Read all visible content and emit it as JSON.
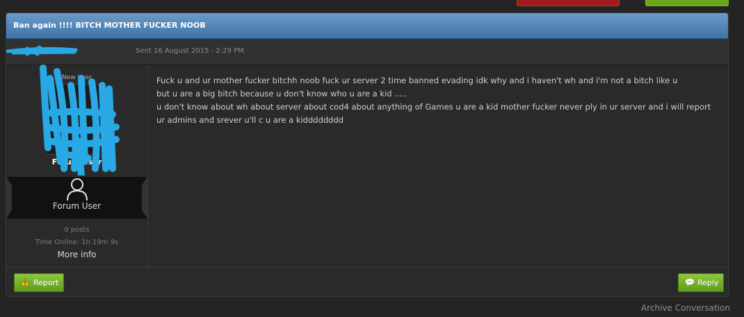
{
  "conversation": {
    "title": "Ban again !!!! BITCH MOTHER FUCKER NOOB",
    "sent": "Sent 16 August 2015 - 2:29 PM"
  },
  "author": {
    "rank": "New User",
    "name": "Forum User",
    "card_label": "Forum User",
    "posts": "0 posts",
    "time_online": "Time Online: 1h 19m 9s",
    "more_info": "More info"
  },
  "message": {
    "lines": [
      "Fuck u and ur mother fucker bitchh noob fuck ur server 2 time banned evading idk why and i haven't wh and i'm not a bitch like u",
      "but u are a big bitch because u don't know who u are a kid .....",
      "u don't know about wh about server about cod4 about anything of Games u are a kid mother fucker never ply in ur server and i will report ur admins and srever u'll c u are a kidddddddd"
    ]
  },
  "buttons": {
    "report": "Report",
    "reply": "Reply",
    "report_icon": "warning-icon",
    "reply_icon": "speech-bubble-icon"
  },
  "archive_link": "Archive Conversation",
  "colors": {
    "title_bar": "#4f84b8",
    "button_green": "#78b02c",
    "background": "#242424"
  }
}
